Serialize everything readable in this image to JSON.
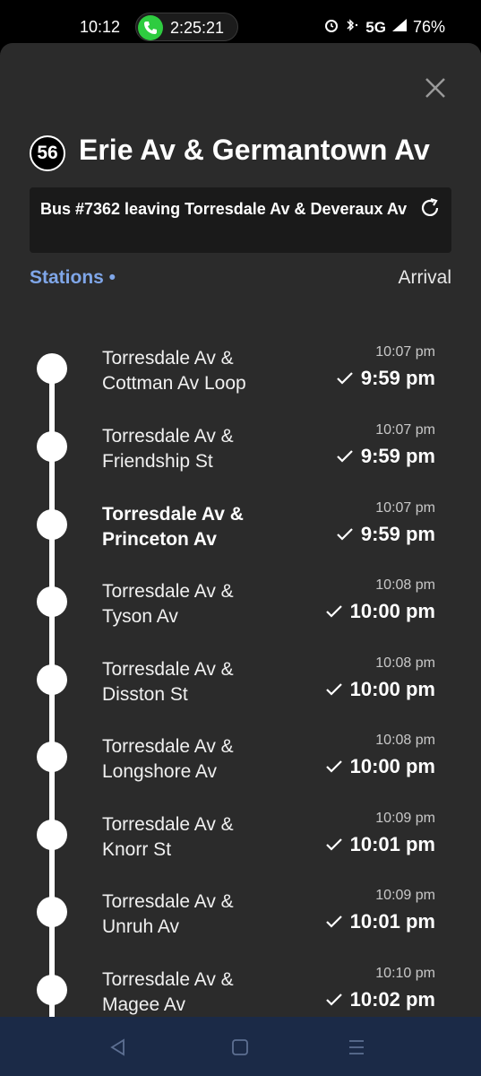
{
  "status_bar": {
    "time": "10:12",
    "call_timer": "2:25:21",
    "network": "5G",
    "battery": "76%"
  },
  "header": {
    "route_number": "56",
    "stop_title": "Erie Av & Germantown Av"
  },
  "bus_banner": {
    "text": "Bus #7362 leaving Torresdale Av & Deveraux Av"
  },
  "tabs": {
    "stations": "Stations •",
    "arrival": "Arrival"
  },
  "stops": [
    {
      "line1": "Torresdale Av &",
      "line2": "Cottman Av Loop",
      "scheduled": "10:07 pm",
      "actual": "9:59 pm",
      "bold": false
    },
    {
      "line1": "Torresdale Av &",
      "line2": "Friendship St",
      "scheduled": "10:07 pm",
      "actual": "9:59 pm",
      "bold": false
    },
    {
      "line1": "Torresdale Av &",
      "line2": "Princeton Av",
      "scheduled": "10:07 pm",
      "actual": "9:59 pm",
      "bold": true
    },
    {
      "line1": "Torresdale Av &",
      "line2": "Tyson Av",
      "scheduled": "10:08 pm",
      "actual": "10:00 pm",
      "bold": false
    },
    {
      "line1": "Torresdale Av &",
      "line2": "Disston St",
      "scheduled": "10:08 pm",
      "actual": "10:00 pm",
      "bold": false
    },
    {
      "line1": "Torresdale Av &",
      "line2": "Longshore Av",
      "scheduled": "10:08 pm",
      "actual": "10:00 pm",
      "bold": false
    },
    {
      "line1": "Torresdale Av &",
      "line2": "Knorr St",
      "scheduled": "10:09 pm",
      "actual": "10:01 pm",
      "bold": false
    },
    {
      "line1": "Torresdale Av &",
      "line2": "Unruh Av",
      "scheduled": "10:09 pm",
      "actual": "10:01 pm",
      "bold": false
    },
    {
      "line1": "Torresdale Av &",
      "line2": "Magee Av",
      "scheduled": "10:10 pm",
      "actual": "10:02 pm",
      "bold": false
    }
  ],
  "colors": {
    "accent": "#7fa6e8",
    "sheet_bg": "#2b2b2b",
    "banner_bg": "#1a1a1a",
    "nav_bg": "#1b2a47",
    "call_green": "#2ecc40"
  },
  "icons": {
    "close": "close-icon",
    "refresh": "refresh-icon",
    "check": "check-icon",
    "call": "phone-icon",
    "nav_back": "triangle-back-icon",
    "nav_home": "square-home-icon",
    "nav_menu": "menu-lines-icon"
  }
}
